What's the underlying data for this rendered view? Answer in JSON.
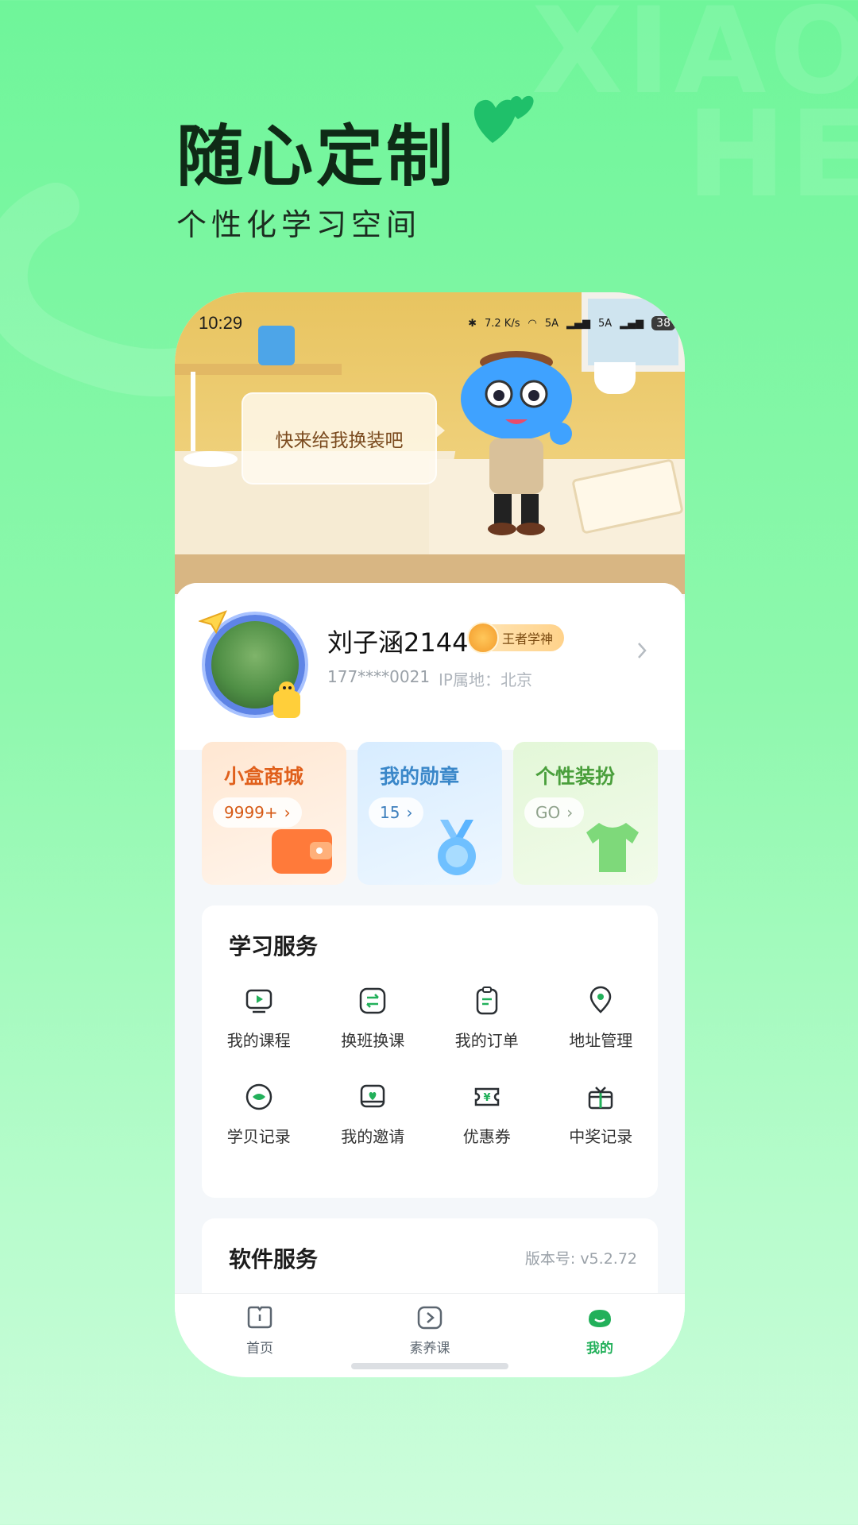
{
  "hero": {
    "title": "随心定制",
    "subtitle": "个性化学习空间",
    "watermark_line1": "XIAO",
    "watermark_line2": "HE"
  },
  "status_bar": {
    "time": "10:29",
    "net_speed": "7.2 K/s",
    "signal1": "5A",
    "signal2": "5A",
    "battery": "38"
  },
  "scene": {
    "bubble_text": "快来给我换装吧"
  },
  "profile": {
    "name": "刘子涵2144",
    "badge": "王者学神",
    "phone": "177****0021",
    "ip_location": "IP属地：北京"
  },
  "cards": [
    {
      "title": "小盒商城",
      "pill": "9999+",
      "icon": "wallet-icon"
    },
    {
      "title": "我的勋章",
      "pill": "15",
      "icon": "medal-icon"
    },
    {
      "title": "个性装扮",
      "pill": "GO",
      "icon": "tshirt-icon"
    }
  ],
  "learning_services": {
    "title": "学习服务",
    "items": [
      {
        "label": "我的课程",
        "icon": "play-course-icon"
      },
      {
        "label": "换班换课",
        "icon": "swap-icon"
      },
      {
        "label": "我的订单",
        "icon": "order-icon"
      },
      {
        "label": "地址管理",
        "icon": "location-icon"
      },
      {
        "label": "学贝记录",
        "icon": "coin-record-icon"
      },
      {
        "label": "我的邀请",
        "icon": "invite-icon"
      },
      {
        "label": "优惠券",
        "icon": "coupon-icon"
      },
      {
        "label": "中奖记录",
        "icon": "gift-icon"
      }
    ]
  },
  "software_services": {
    "title": "软件服务",
    "version": "版本号: v5.2.72"
  },
  "tabbar": {
    "tabs": [
      {
        "label": "首页",
        "icon": "home-book-icon",
        "active": false
      },
      {
        "label": "素养课",
        "icon": "play-box-icon",
        "active": false
      },
      {
        "label": "我的",
        "icon": "profile-cloud-icon",
        "active": true
      }
    ]
  },
  "colors": {
    "accent_green": "#22b05a",
    "shop_orange": "#e0601c",
    "medal_blue": "#3a87c9",
    "dress_green": "#4a9f3c"
  }
}
